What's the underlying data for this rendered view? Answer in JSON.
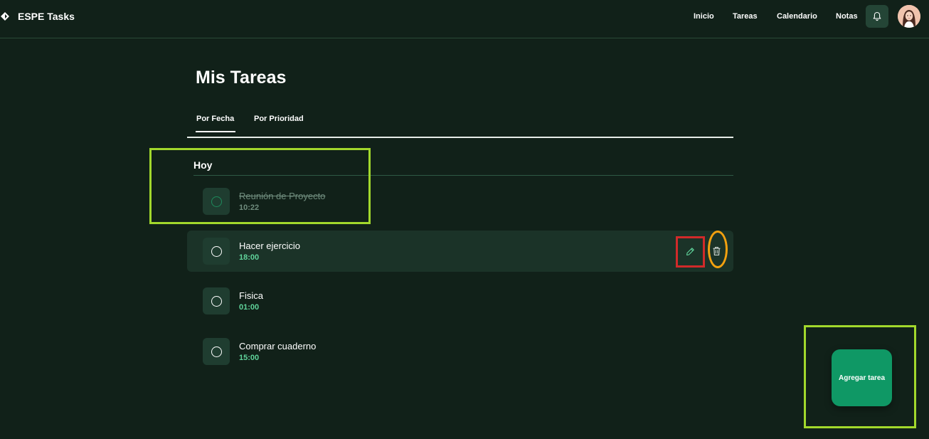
{
  "brand": {
    "title": "ESPE Tasks",
    "logo_icon": "diamond-icon"
  },
  "nav": [
    {
      "label": "Inicio"
    },
    {
      "label": "Tareas"
    },
    {
      "label": "Calendario"
    },
    {
      "label": "Notas"
    }
  ],
  "header_icons": {
    "notifications": "bell-icon",
    "avatar": "user-avatar"
  },
  "page": {
    "title": "Mis Tareas"
  },
  "tabs": [
    {
      "label": "Por Fecha",
      "active": true
    },
    {
      "label": "Por Prioridad",
      "active": false
    }
  ],
  "section": {
    "title": "Hoy"
  },
  "tasks": [
    {
      "title": "Reunión de Proyecto",
      "time": "10:22",
      "completed": true
    },
    {
      "title": "Hacer ejercicio",
      "time": "18:00",
      "completed": false
    },
    {
      "title": "Fisica",
      "time": "01:00",
      "completed": false
    },
    {
      "title": "Comprar cuaderno",
      "time": "15:00",
      "completed": false
    }
  ],
  "task_actions": {
    "edit_icon": "pencil-icon",
    "delete_icon": "trash-icon"
  },
  "fab": {
    "label": "Agregar tarea"
  },
  "colors": {
    "background": "#112119",
    "accent": "#0f9865",
    "time_text": "#5fd39a",
    "highlight_green": "#a2d82c",
    "highlight_red": "#d12a2a",
    "highlight_orange": "#f3a10f"
  }
}
